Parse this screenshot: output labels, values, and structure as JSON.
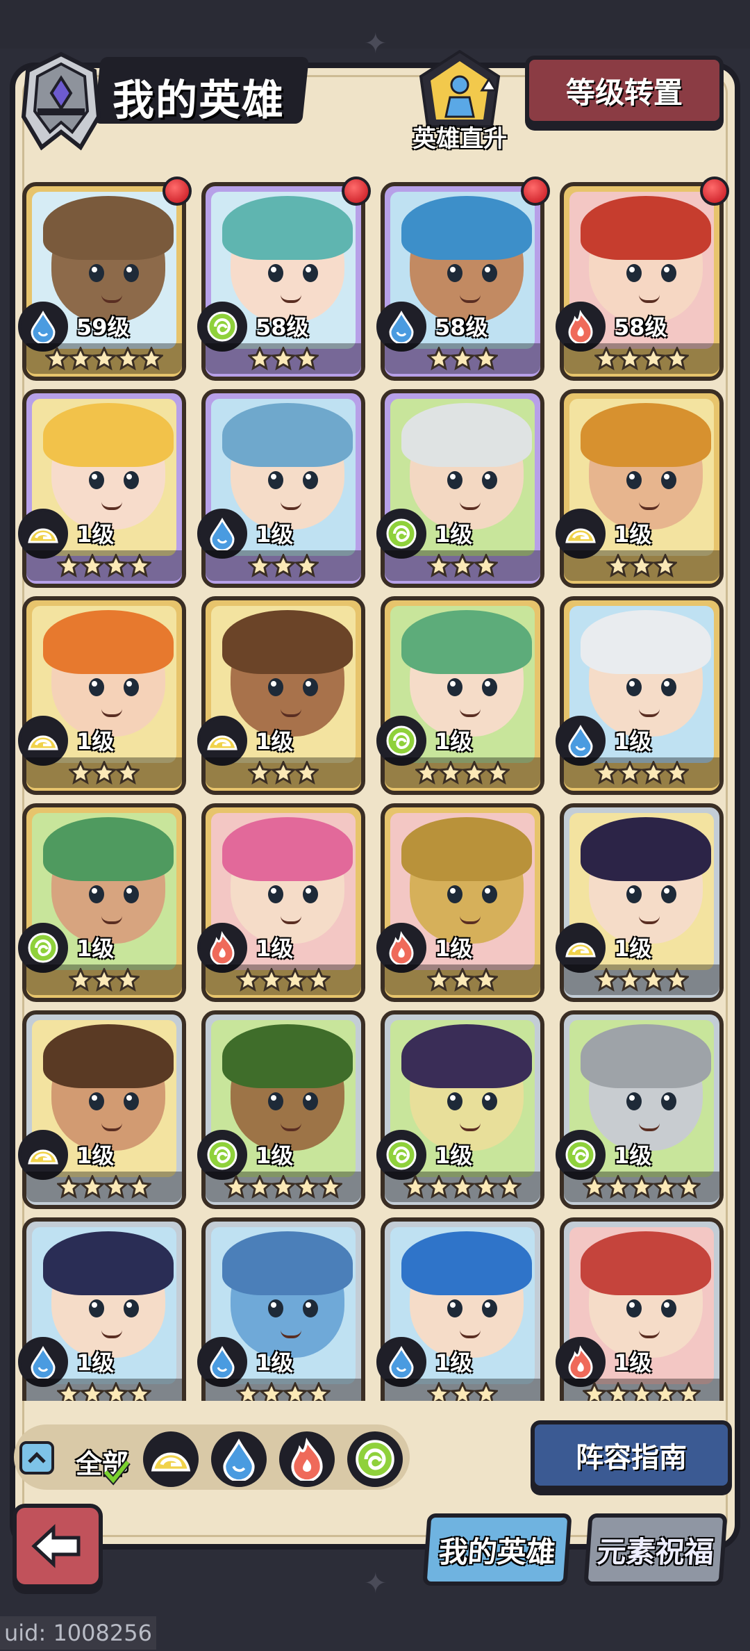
{
  "header": {
    "title": "我的英雄",
    "upgrade_label": "英雄直升",
    "level_transfer_label": "等级转置"
  },
  "heroes": [
    {
      "level": "59级",
      "element": "water",
      "stars": 5,
      "rarity": "gold",
      "red_dot": true,
      "hair": "#7a5a3c",
      "skin": "#8d6a4a",
      "bg": "#d6ecf5"
    },
    {
      "level": "58级",
      "element": "wind",
      "stars": 3,
      "rarity": "purple",
      "red_dot": true,
      "hair": "#5fb5b0",
      "skin": "#f7dccb",
      "bg": "#cfe9f4"
    },
    {
      "level": "58级",
      "element": "water",
      "stars": 3,
      "rarity": "purple",
      "red_dot": true,
      "hair": "#3d8fc9",
      "skin": "#c28a62",
      "bg": "#bfe1f2"
    },
    {
      "level": "58级",
      "element": "fire",
      "stars": 4,
      "rarity": "gold",
      "red_dot": true,
      "hair": "#c63d2e",
      "skin": "#f6d7c3",
      "bg": "#f3c7c4"
    },
    {
      "level": "1级",
      "element": "earth",
      "stars": 4,
      "rarity": "purple",
      "red_dot": false,
      "hair": "#f2c24a",
      "skin": "#f7dccb",
      "bg": "#f3e3a0"
    },
    {
      "level": "1级",
      "element": "water",
      "stars": 3,
      "rarity": "purple",
      "red_dot": false,
      "hair": "#6fa8cc",
      "skin": "#f5dcc8",
      "bg": "#bfe1f2"
    },
    {
      "level": "1级",
      "element": "wind",
      "stars": 3,
      "rarity": "purple",
      "red_dot": false,
      "hair": "#dfe3e3",
      "skin": "#f3d8c2",
      "bg": "#c8e59b"
    },
    {
      "level": "1级",
      "element": "earth",
      "stars": 3,
      "rarity": "gold",
      "red_dot": false,
      "hair": "#d7912f",
      "skin": "#e7b58e",
      "bg": "#f3e3a0"
    },
    {
      "level": "1级",
      "element": "earth",
      "stars": 3,
      "rarity": "gold",
      "red_dot": false,
      "hair": "#e7792e",
      "skin": "#f5d2b8",
      "bg": "#f3e3a0"
    },
    {
      "level": "1级",
      "element": "earth",
      "stars": 3,
      "rarity": "gold",
      "red_dot": false,
      "hair": "#6b4428",
      "skin": "#a8724b",
      "bg": "#f3e3a0"
    },
    {
      "level": "1级",
      "element": "wind",
      "stars": 4,
      "rarity": "gold",
      "red_dot": false,
      "hair": "#5dac7a",
      "skin": "#f5dcc8",
      "bg": "#c8e59b"
    },
    {
      "level": "1级",
      "element": "water",
      "stars": 4,
      "rarity": "gold",
      "red_dot": false,
      "hair": "#e9ecef",
      "skin": "#f5dcc8",
      "bg": "#bfe1f2"
    },
    {
      "level": "1级",
      "element": "wind",
      "stars": 3,
      "rarity": "gold",
      "red_dot": false,
      "hair": "#4f9a5f",
      "skin": "#d7a47f",
      "bg": "#c8e59b"
    },
    {
      "level": "1级",
      "element": "fire",
      "stars": 4,
      "rarity": "gold",
      "red_dot": false,
      "hair": "#e2699a",
      "skin": "#f5dcc8",
      "bg": "#f3c7c4"
    },
    {
      "level": "1级",
      "element": "fire",
      "stars": 3,
      "rarity": "gold",
      "red_dot": false,
      "hair": "#b9923a",
      "skin": "#d6b05a",
      "bg": "#f3c7c4"
    },
    {
      "level": "1级",
      "element": "earth",
      "stars": 4,
      "rarity": "silver",
      "red_dot": false,
      "hair": "#2c2447",
      "skin": "#f5dcc8",
      "bg": "#f3e3a0"
    },
    {
      "level": "1级",
      "element": "earth",
      "stars": 4,
      "rarity": "silver",
      "red_dot": false,
      "hair": "#5a3a24",
      "skin": "#d29b72",
      "bg": "#f3e3a0"
    },
    {
      "level": "1级",
      "element": "wind",
      "stars": 5,
      "rarity": "silver",
      "red_dot": false,
      "hair": "#3f6d2a",
      "skin": "#9d7447",
      "bg": "#c8e59b"
    },
    {
      "level": "1级",
      "element": "wind",
      "stars": 5,
      "rarity": "silver",
      "red_dot": false,
      "hair": "#3a2d57",
      "skin": "#e8df9a",
      "bg": "#c8e59b"
    },
    {
      "level": "1级",
      "element": "wind",
      "stars": 5,
      "rarity": "silver",
      "red_dot": false,
      "hair": "#9ea3a8",
      "skin": "#c8ccd0",
      "bg": "#c8e59b"
    },
    {
      "level": "1级",
      "element": "water",
      "stars": 4,
      "rarity": "silver",
      "red_dot": false,
      "hair": "#2a2d55",
      "skin": "#f5dcc8",
      "bg": "#bfe1f2"
    },
    {
      "level": "1级",
      "element": "water",
      "stars": 4,
      "rarity": "silver",
      "red_dot": false,
      "hair": "#4b7fb9",
      "skin": "#6fa9d8",
      "bg": "#bfe1f2"
    },
    {
      "level": "1级",
      "element": "water",
      "stars": 3,
      "rarity": "silver",
      "red_dot": false,
      "hair": "#2f74c9",
      "skin": "#f5dcc8",
      "bg": "#bfe1f2"
    },
    {
      "level": "1级",
      "element": "fire",
      "stars": 5,
      "rarity": "silver",
      "red_dot": false,
      "hair": "#c5443c",
      "skin": "#f5dcc8",
      "bg": "#f3c7c4"
    }
  ],
  "filters": {
    "all_label": "全部",
    "elements": [
      "earth",
      "water",
      "fire",
      "wind"
    ]
  },
  "guide_label": "阵容指南",
  "tabs": {
    "my_heroes": "我的英雄",
    "element_blessing": "元素祝福"
  },
  "uid_text": "uid: 1008256",
  "colors": {
    "water": "#4a9be0",
    "wind": "#8fd13b",
    "fire": "#ef6a5a",
    "earth": "#f0d24a",
    "gold_frame": "#e7c46c",
    "purple_frame": "#b7a0e8",
    "silver_frame": "#c3cdd6"
  }
}
